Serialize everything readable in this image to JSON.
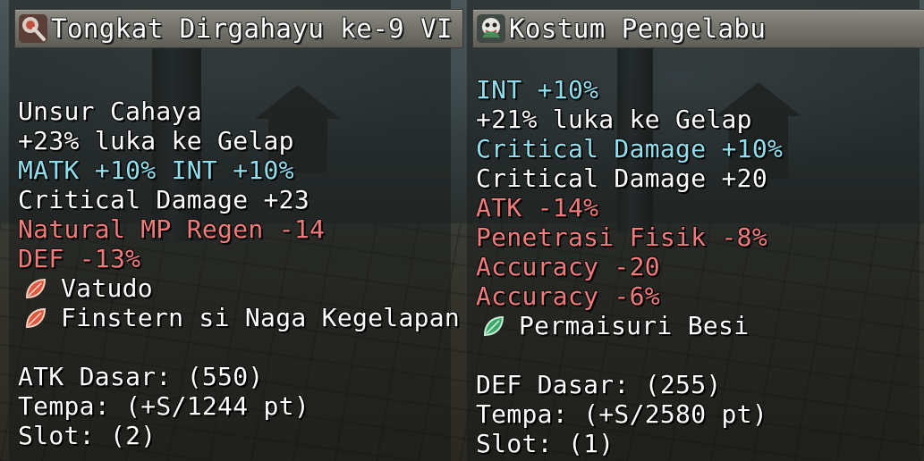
{
  "left_item": {
    "icon": "staff-icon",
    "title": "Tongkat Dirgahayu ke-9 VI",
    "stats": [
      {
        "text": "Unsur Cahaya",
        "color": "white"
      },
      {
        "text": "+23% luka ke Gelap",
        "color": "white"
      },
      {
        "text": "MATK +10% INT +10%",
        "color": "cyan"
      },
      {
        "text": "Critical Damage +23",
        "color": "white"
      },
      {
        "text": "Natural MP Regen -14",
        "color": "red"
      },
      {
        "text": "DEF -13%",
        "color": "red"
      }
    ],
    "crystals": [
      {
        "icon": "red-crystal-icon",
        "text": "Vatudo"
      },
      {
        "icon": "red-crystal-icon",
        "text": "Finstern si Naga Kegelapan"
      }
    ],
    "base": "ATK Dasar: (550)",
    "refine": "Tempa: (+S/1244 pt)",
    "slot": "Slot: (2)"
  },
  "right_item": {
    "icon": "costume-icon",
    "title": "Kostum Pengelabu",
    "stats": [
      {
        "text": "INT +10%",
        "color": "cyan"
      },
      {
        "text": "+21% luka ke Gelap",
        "color": "white"
      },
      {
        "text": "Critical Damage +10%",
        "color": "cyan"
      },
      {
        "text": "Critical Damage +20",
        "color": "white"
      },
      {
        "text": "ATK -14%",
        "color": "red"
      },
      {
        "text": "Penetrasi Fisik -8%",
        "color": "red"
      },
      {
        "text": "Accuracy -20",
        "color": "red"
      },
      {
        "text": "Accuracy -6%",
        "color": "red"
      }
    ],
    "crystals": [
      {
        "icon": "green-crystal-icon",
        "text": "Permaisuri Besi"
      }
    ],
    "base": "DEF Dasar: (255)",
    "refine": "Tempa: (+S/2580 pt)",
    "slot": "Slot: (1)"
  },
  "colors": {
    "white": "#ffffff",
    "cyan": "#8fe0ef",
    "red": "#f07b7a"
  }
}
